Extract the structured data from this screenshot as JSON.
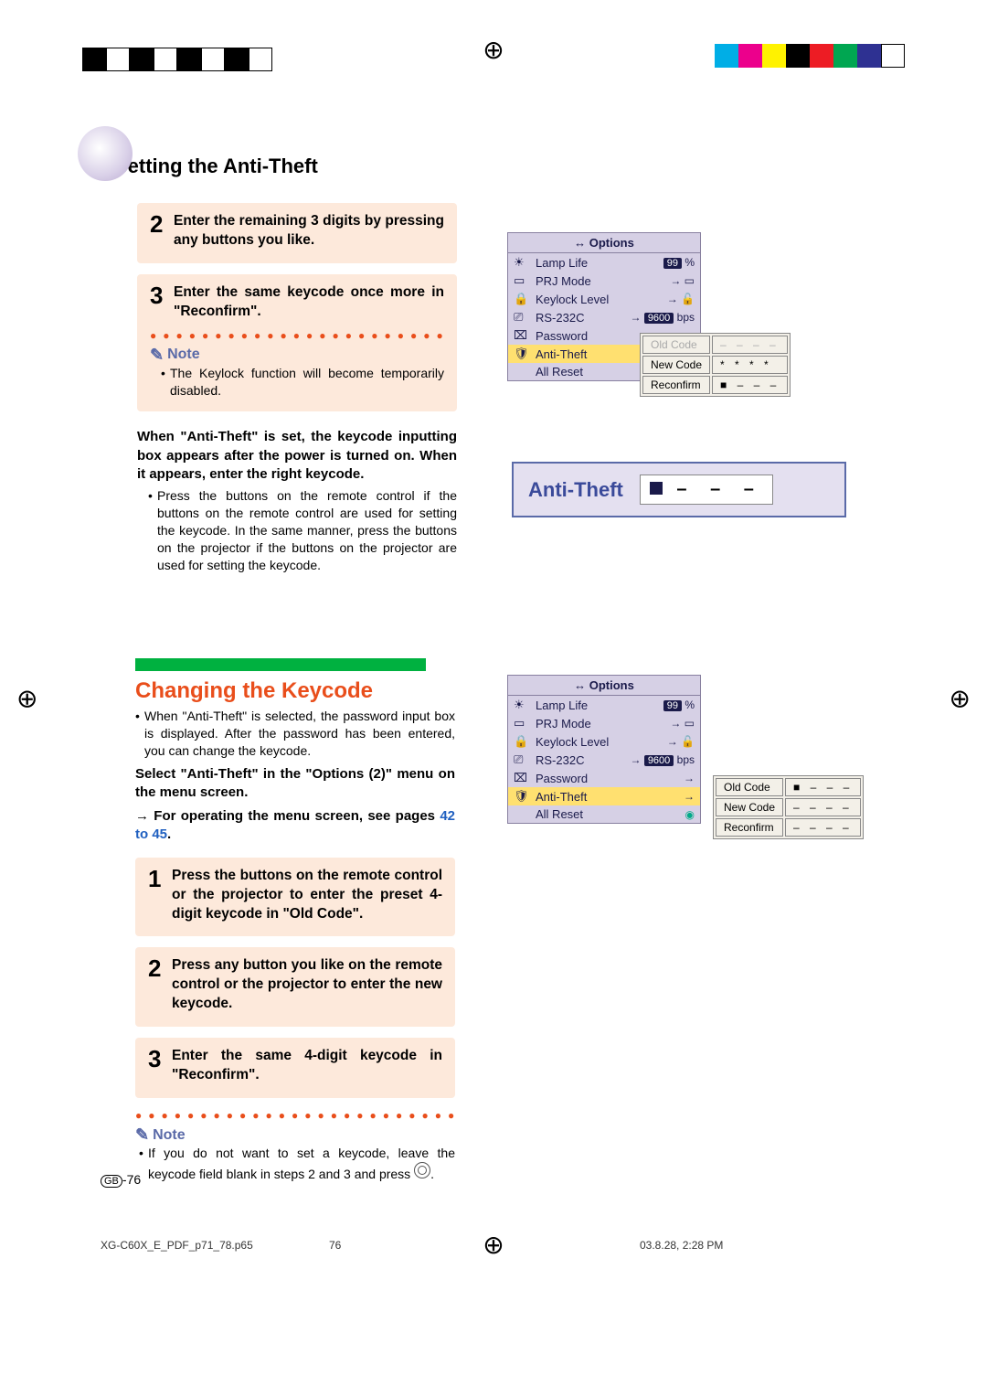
{
  "header": {
    "title": "Setting the Anti-Theft"
  },
  "steps_a": [
    {
      "num": "2",
      "text": "Enter the remaining 3 digits by pressing any buttons you like."
    },
    {
      "num": "3",
      "text": "Enter the same keycode once more in \"Reconfirm\"."
    }
  ],
  "note1": {
    "label": "Note",
    "bullet": "The Keylock function will become temporarily disabled."
  },
  "para1": {
    "bold": "When \"Anti-Theft\" is set, the keycode inputting box appears after the power is turned on. When it appears, enter the right keycode.",
    "bullet": "Press the buttons on the remote control if the buttons on the remote control are used for setting the keycode. In the same manner, press the buttons on the projector if the buttons on the projector are used for setting the keycode."
  },
  "changing": {
    "title": "Changing the Keycode",
    "intro": "When \"Anti-Theft\" is selected, the password input box is displayed. After the password has been entered, you can change the keycode.",
    "select": "Select \"Anti-Theft\" in the \"Options (2)\" menu on the menu screen.",
    "arrow_line_prefix": "→ For operating the menu screen, see pages ",
    "arrow_line_link": "42 to 45",
    "arrow_line_suffix": "."
  },
  "steps_b": [
    {
      "num": "1",
      "text": "Press the buttons on the remote control or the projector to enter the preset 4-digit keycode in \"Old Code\"."
    },
    {
      "num": "2",
      "text": "Press any button you like on the remote control or the projector to enter the new keycode."
    },
    {
      "num": "3",
      "text": "Enter the same 4-digit keycode in \"Reconfirm\"."
    }
  ],
  "note2": {
    "label": "Note",
    "bullet_prefix": "If you do not want to set a keycode, leave the keycode field blank in steps 2 and 3 and press ",
    "bullet_suffix": "."
  },
  "osd1": {
    "header": "Options",
    "rows": [
      {
        "icon": "☀",
        "label": "Lamp Life",
        "val": "99",
        "unit": "%"
      },
      {
        "icon": "▭",
        "label": "PRJ Mode",
        "val": "→",
        "unit": "▭"
      },
      {
        "icon": "🔒",
        "label": "Keylock Level",
        "val": "→",
        "unit": "🔓"
      },
      {
        "icon": "⎚",
        "label": "RS-232C",
        "val": "→ 9600",
        "unit": "bps"
      },
      {
        "icon": "⌧",
        "label": "Password",
        "val": "→",
        "unit": ""
      },
      {
        "icon": "🛡",
        "label": "Anti-Theft",
        "val": "→",
        "unit": "",
        "highlight": true
      },
      {
        "icon": "",
        "label": "All Reset",
        "val": "◉",
        "unit": ""
      }
    ]
  },
  "code_table1": {
    "rows": [
      {
        "label": "Old Code",
        "val": "– – – –",
        "dim": true
      },
      {
        "label": "New Code",
        "val": "* * * *"
      },
      {
        "label": "Reconfirm",
        "val": "■ – – –"
      }
    ]
  },
  "anti_theft_box": {
    "label": "Anti-Theft",
    "value_display": "■ – – –"
  },
  "osd2": {
    "header": "Options",
    "rows": [
      {
        "icon": "☀",
        "label": "Lamp Life",
        "val": "99",
        "unit": "%"
      },
      {
        "icon": "▭",
        "label": "PRJ Mode",
        "val": "→",
        "unit": "▭"
      },
      {
        "icon": "🔒",
        "label": "Keylock Level",
        "val": "→",
        "unit": "🔓"
      },
      {
        "icon": "⎚",
        "label": "RS-232C",
        "val": "→ 9600",
        "unit": "bps"
      },
      {
        "icon": "⌧",
        "label": "Password",
        "val": "→",
        "unit": ""
      },
      {
        "icon": "🛡",
        "label": "Anti-Theft",
        "val": "→",
        "unit": "",
        "highlight": true
      },
      {
        "icon": "",
        "label": "All Reset",
        "val": "◉",
        "unit": ""
      }
    ]
  },
  "code_table2": {
    "rows": [
      {
        "label": "Old Code",
        "val": "■ – – –"
      },
      {
        "label": "New Code",
        "val": "– – – –"
      },
      {
        "label": "Reconfirm",
        "val": "– – – –"
      }
    ]
  },
  "page_number": "-76",
  "footer": {
    "filename": "XG-C60X_E_PDF_p71_78.p65",
    "page": "76",
    "date": "03.8.28, 2:28 PM"
  }
}
